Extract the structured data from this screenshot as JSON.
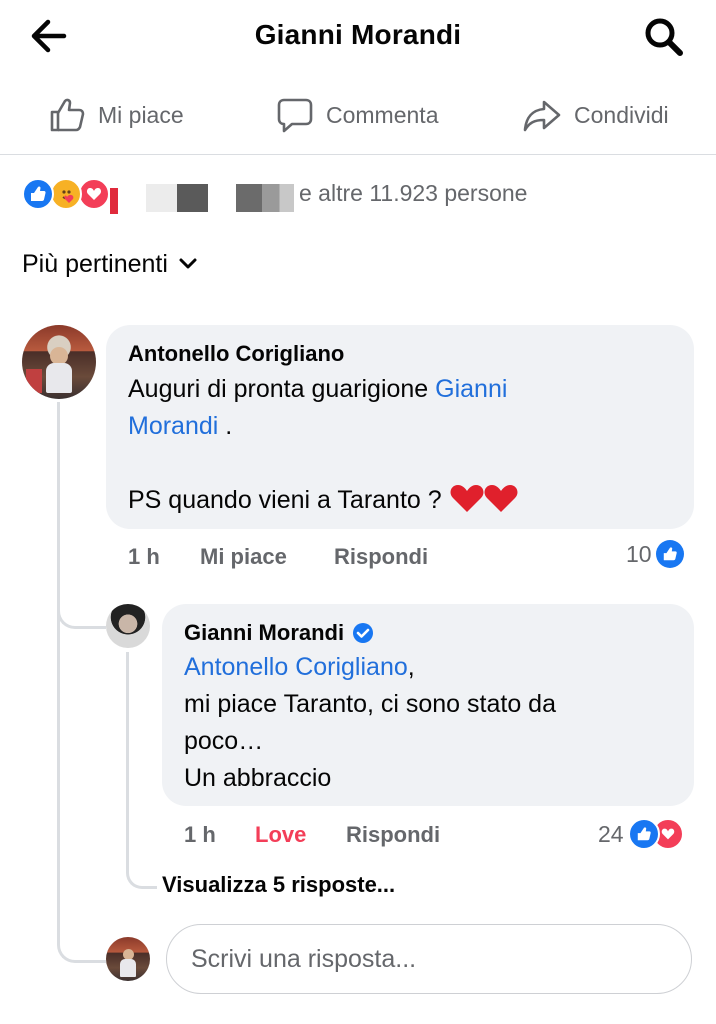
{
  "header": {
    "title": "Gianni Morandi",
    "back_icon": "arrow-left-icon",
    "search_icon": "search-icon"
  },
  "actions": {
    "like_label": "Mi piace",
    "comment_label": "Commenta",
    "share_label": "Condividi"
  },
  "reactions_summary": {
    "icons": [
      "like-icon",
      "care-icon",
      "love-icon"
    ],
    "text": "e altre 11.923 persone"
  },
  "sort": {
    "label": "Più pertinenti",
    "icon": "chevron-down-icon"
  },
  "comment": {
    "author": "Antonello Corigliano",
    "text_before_mention": "Auguri di pronta guarigione ",
    "mention_line1": "Gianni",
    "mention_line2": "Morandi",
    "text_after_mention": " .",
    "text_ps": "PS quando vieni a Taranto ? ",
    "emoji": "❤️❤️",
    "time": "1 h",
    "like_label": "Mi piace",
    "reply_label": "Rispondi",
    "reaction_count": "10",
    "reaction_icons": [
      "like-icon"
    ]
  },
  "reply": {
    "author": "Gianni Morandi",
    "verified_icon": "verified-badge-icon",
    "mention": "Antonello Corigliano",
    "mention_suffix": ",",
    "line2": "mi piace Taranto, ci sono stato da",
    "line3": "poco…",
    "line4": "Un abbraccio",
    "time": "1 h",
    "reaction_label": "Love",
    "reply_label": "Rispondi",
    "reaction_count": "24",
    "reaction_icons": [
      "like-icon",
      "love-icon"
    ]
  },
  "view_replies": "Visualizza 5 risposte...",
  "reply_input": {
    "placeholder": "Scrivi una risposta..."
  },
  "colors": {
    "link": "#216fdb",
    "secondary_text": "#65676b",
    "bubble_bg": "#f0f2f5",
    "like_blue": "#1877f2",
    "love_red": "#f33e58"
  }
}
